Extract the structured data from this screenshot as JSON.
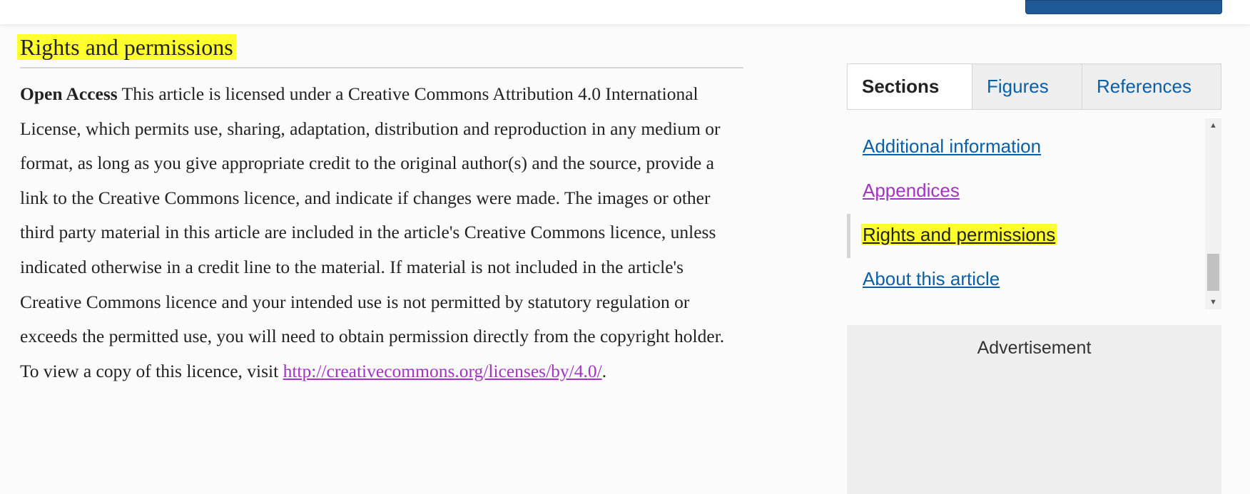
{
  "section": {
    "title": "Rights and permissions",
    "open_access_label": "Open Access",
    "body": " This article is licensed under a Creative Commons Attribution 4.0 International License, which permits use, sharing, adaptation, distribution and reproduction in any medium or format, as long as you give appropriate credit to the original author(s) and the source, provide a link to the Creative Commons licence, and indicate if changes were made. The images or other third party material in this article are included in the article's Creative Commons licence, unless indicated otherwise in a credit line to the material. If material is not included in the article's Creative Commons licence and your intended use is not permitted by statutory regulation or exceeds the permitted use, you will need to obtain permission directly from the copyright holder. To view a copy of this licence, visit ",
    "license_link": "http://creativecommons.org/licenses/by/4.0/",
    "trailing": "."
  },
  "sidebar": {
    "tabs": [
      {
        "label": "Sections",
        "active": true
      },
      {
        "label": "Figures",
        "active": false
      },
      {
        "label": "References",
        "active": false
      }
    ],
    "nav_items": [
      {
        "label": "Additional information",
        "state": "link"
      },
      {
        "label": "Appendices",
        "state": "visited"
      },
      {
        "label": "Rights and permissions",
        "state": "current"
      },
      {
        "label": "About this article",
        "state": "link"
      }
    ],
    "scroll_up_glyph": "▲",
    "scroll_down_glyph": "▼"
  },
  "advertisement": {
    "label": "Advertisement"
  },
  "colors": {
    "highlight": "#ffff2e",
    "link": "#0b5fa5",
    "visited_link": "#a233c4",
    "top_button": "#1f5a96"
  }
}
